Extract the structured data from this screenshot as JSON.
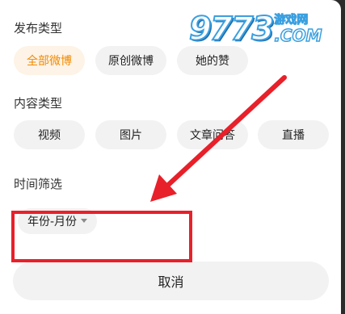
{
  "sections": {
    "publish_type": {
      "title": "发布类型",
      "options": [
        "全部微博",
        "原创微博",
        "她的赞"
      ],
      "selected": "全部微博"
    },
    "content_type": {
      "title": "内容类型",
      "options": [
        "视频",
        "图片",
        "文章问答",
        "直播"
      ]
    },
    "time_filter": {
      "title": "时间筛选",
      "dropdown_label": "年份-月份"
    }
  },
  "cancel_label": "取消",
  "watermark": {
    "number": "9773",
    "cn_text": "游戏网",
    "com_text": ".COM"
  },
  "colors": {
    "accent": "#f28a00",
    "accent_bg": "#fdf3e6",
    "chip_bg": "#f2f2f2",
    "annotation_red": "#e8202a",
    "watermark_blue": "#3aa0e0"
  }
}
